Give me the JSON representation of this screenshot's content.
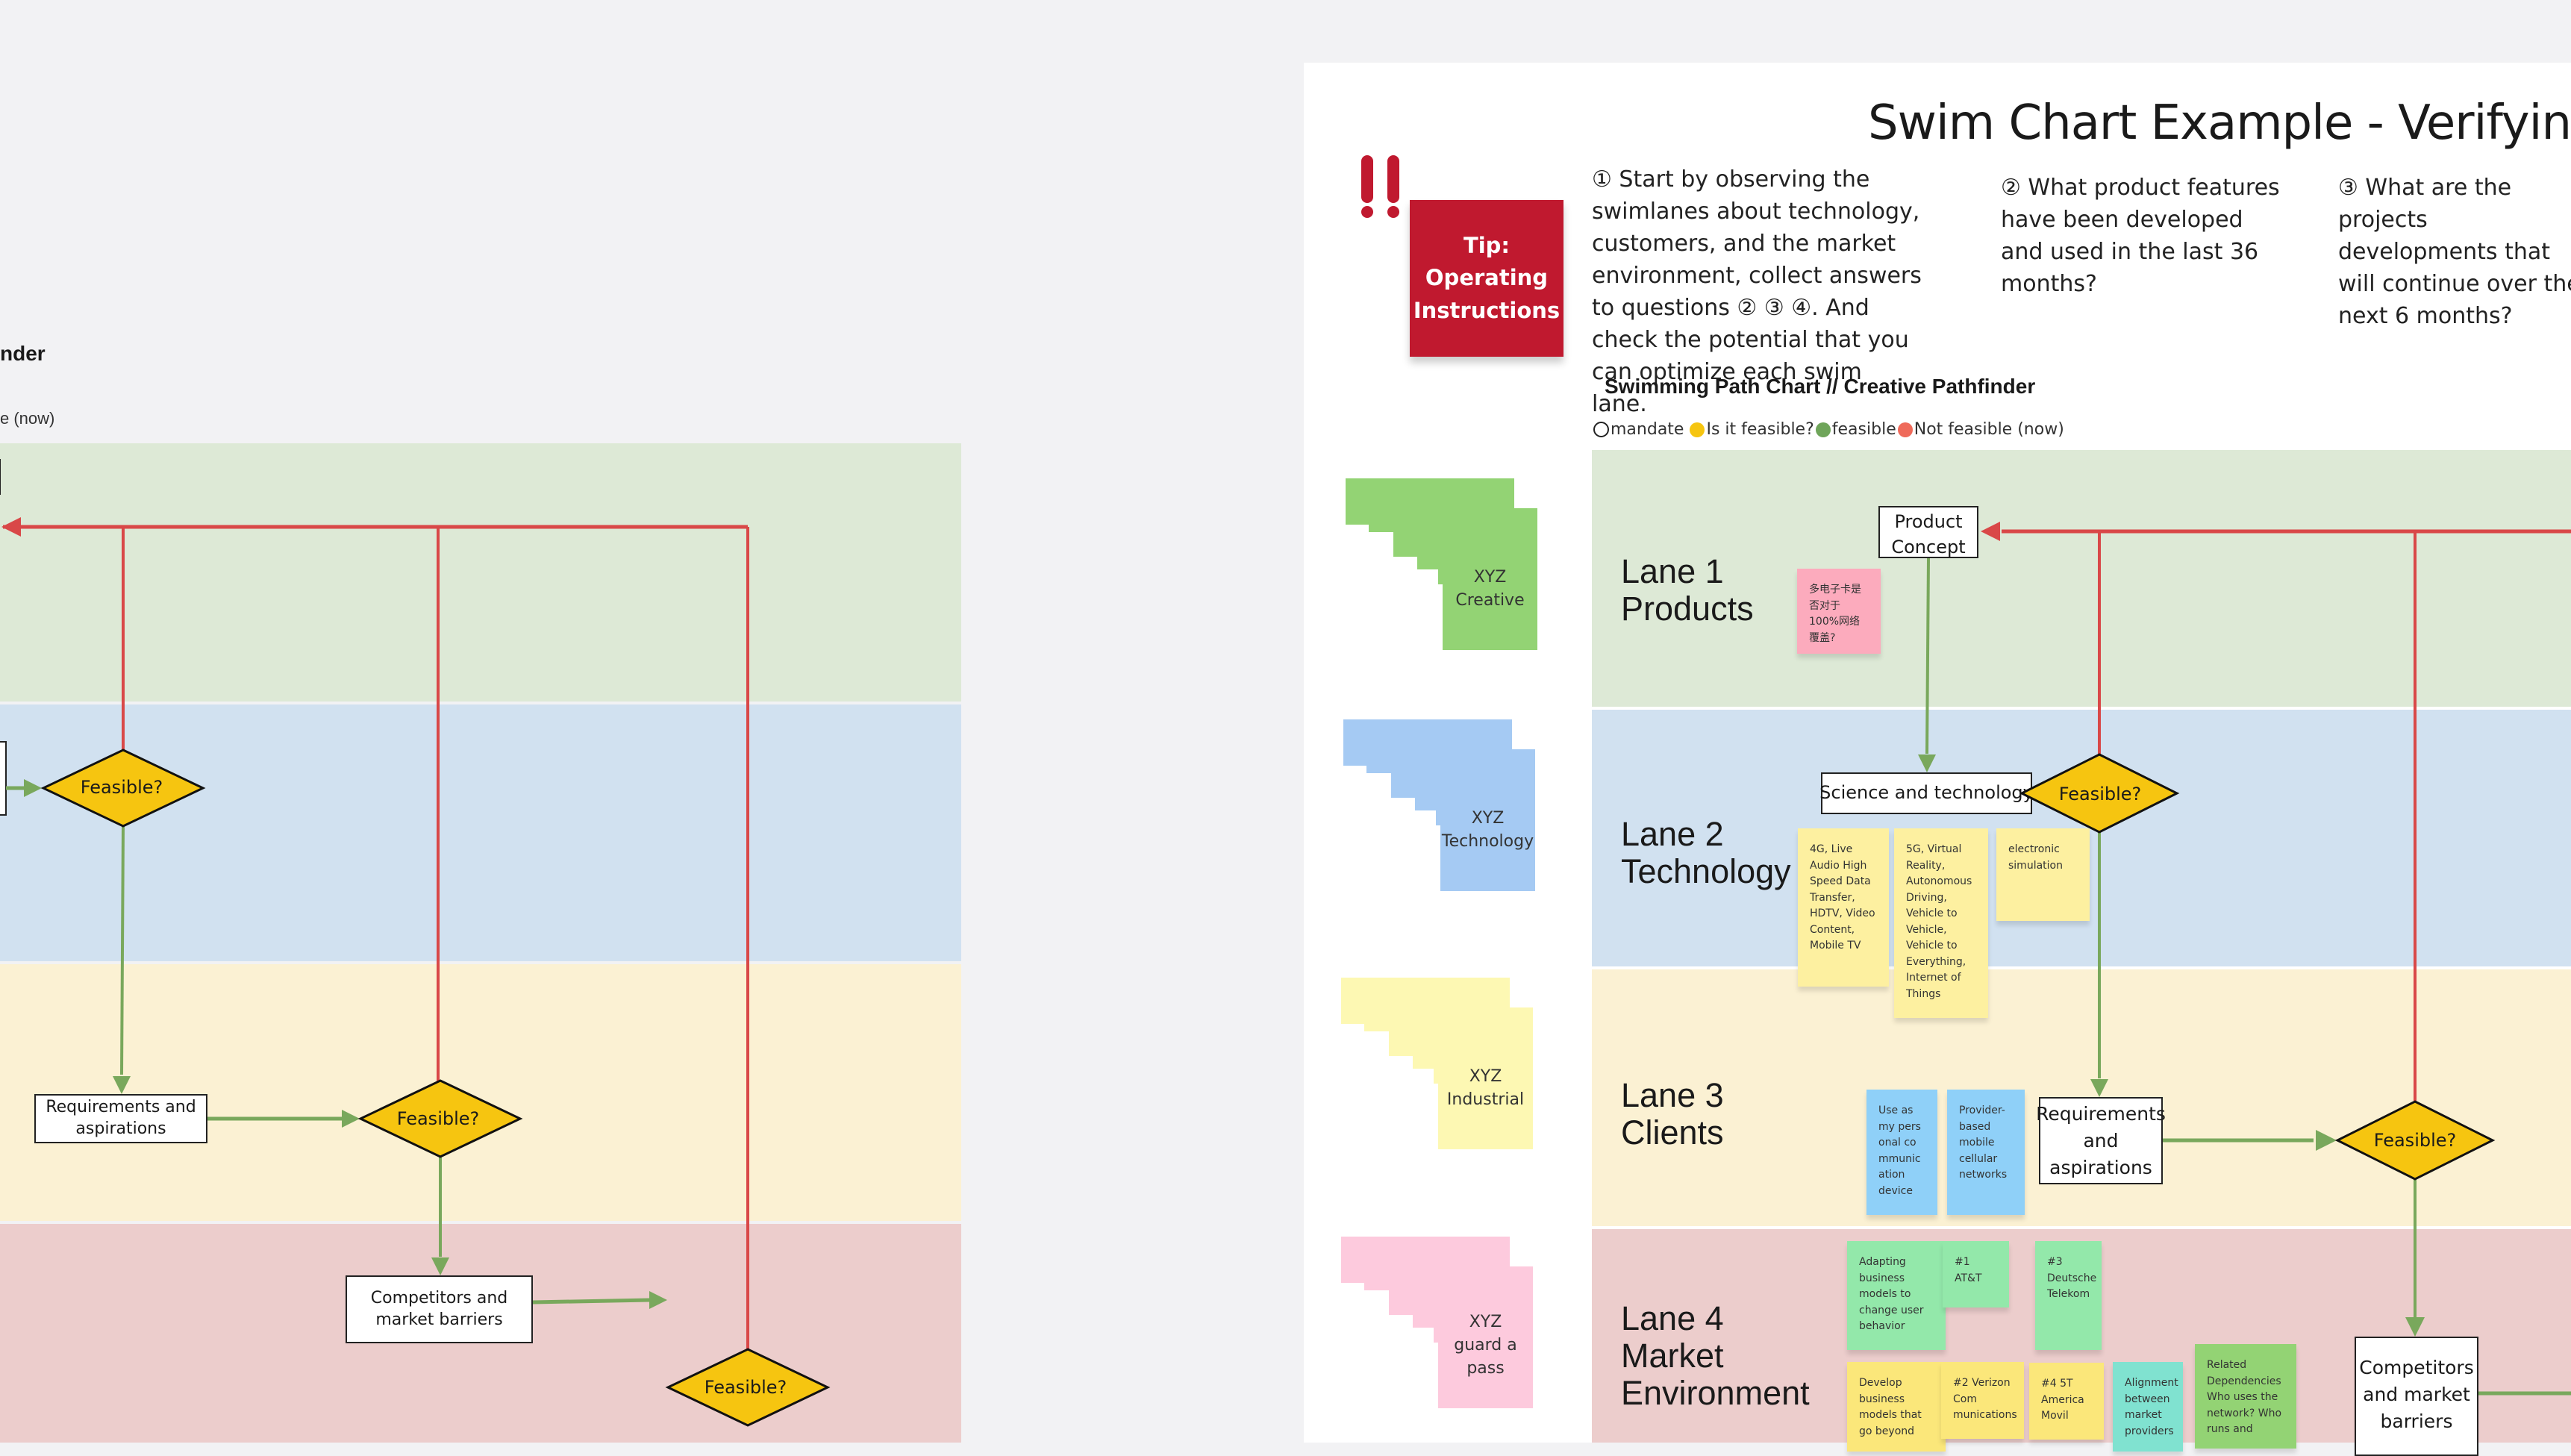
{
  "left_board": {
    "title_fragment": "nder",
    "legend_fragment": "e (now)",
    "nodes": {
      "feasible_1": "Feasible?",
      "requirements": "Requirements and aspirations",
      "feasible_2": "Feasible?",
      "competitors": "Competitors and market barriers",
      "feasible_3": "Feasible?"
    }
  },
  "right_board": {
    "title": "Swim Chart Example - Verifying Pro",
    "tip": {
      "icon": "double-exclamation-icon",
      "label": "Tip: Operating Instructions"
    },
    "questions": [
      "① Start by observing the swimlanes about technology, customers, and the market environment, collect answers to questions ② ③ ④. And check the potential that you can optimize each swim lane.",
      "② What product features have been developed and used in the last 36 months?",
      "③ What are the projects developments that will continue over the next 6 months?"
    ],
    "subtitle": "Swimming Path Chart // Creative Pathfinder",
    "legend": [
      {
        "label": "mandate",
        "color": "#ffffff",
        "outline": true
      },
      {
        "label": "Is it feasible?",
        "color": "#f6c510"
      },
      {
        "label": "feasible",
        "color": "#6fa55a"
      },
      {
        "label": "Not feasible (now)",
        "color": "#ef6a5a"
      }
    ],
    "stacks": [
      {
        "line1": "XYZ",
        "line2": "Creative",
        "color": "#93d374"
      },
      {
        "line1": "XYZ",
        "line2": "Technology",
        "color": "#a5caf3"
      },
      {
        "line1": "XYZ",
        "line2": "Industrial",
        "color": "#fdf8b3"
      },
      {
        "line1": "XYZ",
        "line2": "guard a pass",
        "color": "#fdcadd"
      }
    ],
    "lanes": [
      {
        "title": "Lane 1",
        "subtitle": "Products"
      },
      {
        "title": "Lane 2",
        "subtitle": "Technology"
      },
      {
        "title": "Lane 3",
        "subtitle": "Clients"
      },
      {
        "title": "Lane 4",
        "subtitle": "Market Environment"
      }
    ],
    "nodes": {
      "product_concept": "Product Concept",
      "science_tech": "Science and technology",
      "feasible_1": "Feasible?",
      "requirements": "Requirements and aspirations",
      "feasible_2": "Feasible?",
      "competitors": "Competitors and market barriers"
    },
    "stickies": {
      "lane1": [
        {
          "text": "多电子卡是否对于100%网络覆盖?",
          "color": "#fcabbd"
        }
      ],
      "lane2": [
        {
          "text": "4G, Live Audio High Speed Data Transfer, HDTV, Video Content, Mobile TV",
          "color": "#fdf0a0"
        },
        {
          "text": "5G, Virtual Reality, Autonomous Driving, Vehicle to Vehicle, Vehicle to Everything, Internet of Things",
          "color": "#fdf0a0"
        },
        {
          "text": "electronic simulation",
          "color": "#fdf0a0"
        }
      ],
      "lane3": [
        {
          "text": "Use as my pers onal co mmunic ation device",
          "color": "#8fd0f8"
        },
        {
          "text": "Provider-based mobile cellular networks",
          "color": "#8fd0f8"
        }
      ],
      "lane4": [
        {
          "text": "Adapting business models to change user behavior",
          "color": "#93e8aa"
        },
        {
          "text": "#1 AT&T",
          "color": "#93e8aa"
        },
        {
          "text": "#3 Deutsche Telekom",
          "color": "#93e8aa"
        },
        {
          "text": "Develop business models that go beyond",
          "color": "#fbe77a"
        },
        {
          "text": "#2 Verizon Com munications",
          "color": "#fbe77a"
        },
        {
          "text": "#4 5T America Movil",
          "color": "#fbe77a"
        },
        {
          "text": "Alignment between market providers",
          "color": "#80e2d0"
        },
        {
          "text": "Related Dependencies Who uses the network? Who runs and",
          "color": "#93d374"
        }
      ]
    }
  },
  "colors": {
    "canvas_bg": "#f2f2f4",
    "diamond": "#f6c510",
    "feasible_line": "#79a85c",
    "not_feasible_line": "#d94848",
    "tip_red": "#c0192f"
  }
}
